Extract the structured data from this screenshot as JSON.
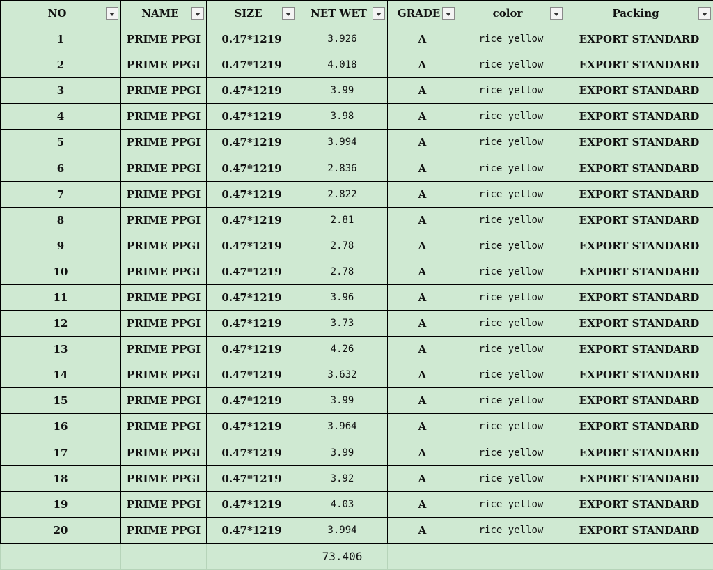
{
  "headers": [
    "NO",
    "NAME",
    "SIZE",
    "NET WET",
    "GRADE",
    "color",
    "Packing"
  ],
  "rows": [
    [
      "1",
      "PRIME PPGI",
      "0.47*1219",
      "3.926",
      "A",
      "rice yellow",
      "EXPORT STANDARD"
    ],
    [
      "2",
      "PRIME PPGI",
      "0.47*1219",
      "4.018",
      "A",
      "rice yellow",
      "EXPORT STANDARD"
    ],
    [
      "3",
      "PRIME PPGI",
      "0.47*1219",
      "3.99",
      "A",
      "rice yellow",
      "EXPORT STANDARD"
    ],
    [
      "4",
      "PRIME PPGI",
      "0.47*1219",
      "3.98",
      "A",
      "rice yellow",
      "EXPORT STANDARD"
    ],
    [
      "5",
      "PRIME PPGI",
      "0.47*1219",
      "3.994",
      "A",
      "rice yellow",
      "EXPORT STANDARD"
    ],
    [
      "6",
      "PRIME PPGI",
      "0.47*1219",
      "2.836",
      "A",
      "rice yellow",
      "EXPORT STANDARD"
    ],
    [
      "7",
      "PRIME PPGI",
      "0.47*1219",
      "2.822",
      "A",
      "rice yellow",
      "EXPORT STANDARD"
    ],
    [
      "8",
      "PRIME PPGI",
      "0.47*1219",
      "2.81",
      "A",
      "rice yellow",
      "EXPORT STANDARD"
    ],
    [
      "9",
      "PRIME PPGI",
      "0.47*1219",
      "2.78",
      "A",
      "rice yellow",
      "EXPORT STANDARD"
    ],
    [
      "10",
      "PRIME PPGI",
      "0.47*1219",
      "2.78",
      "A",
      "rice yellow",
      "EXPORT STANDARD"
    ],
    [
      "11",
      "PRIME PPGI",
      "0.47*1219",
      "3.96",
      "A",
      "rice yellow",
      "EXPORT STANDARD"
    ],
    [
      "12",
      "PRIME PPGI",
      "0.47*1219",
      "3.73",
      "A",
      "rice yellow",
      "EXPORT STANDARD"
    ],
    [
      "13",
      "PRIME PPGI",
      "0.47*1219",
      "4.26",
      "A",
      "rice yellow",
      "EXPORT STANDARD"
    ],
    [
      "14",
      "PRIME PPGI",
      "0.47*1219",
      "3.632",
      "A",
      "rice yellow",
      "EXPORT STANDARD"
    ],
    [
      "15",
      "PRIME PPGI",
      "0.47*1219",
      "3.99",
      "A",
      "rice yellow",
      "EXPORT STANDARD"
    ],
    [
      "16",
      "PRIME PPGI",
      "0.47*1219",
      "3.964",
      "A",
      "rice yellow",
      "EXPORT STANDARD"
    ],
    [
      "17",
      "PRIME PPGI",
      "0.47*1219",
      "3.99",
      "A",
      "rice yellow",
      "EXPORT STANDARD"
    ],
    [
      "18",
      "PRIME PPGI",
      "0.47*1219",
      "3.92",
      "A",
      "rice yellow",
      "EXPORT STANDARD"
    ],
    [
      "19",
      "PRIME PPGI",
      "0.47*1219",
      "4.03",
      "A",
      "rice yellow",
      "EXPORT STANDARD"
    ],
    [
      "20",
      "PRIME PPGI",
      "0.47*1219",
      "3.994",
      "A",
      "rice yellow",
      "EXPORT STANDARD"
    ]
  ],
  "total": "73.406",
  "colors": {
    "cell_background": "#cfe9d2",
    "grid_line": "#000000",
    "footer_grid_line": "#b6d4b9",
    "filter_button_background": "#f4f4f4"
  },
  "icons": {
    "filter": "filter-dropdown-icon"
  }
}
